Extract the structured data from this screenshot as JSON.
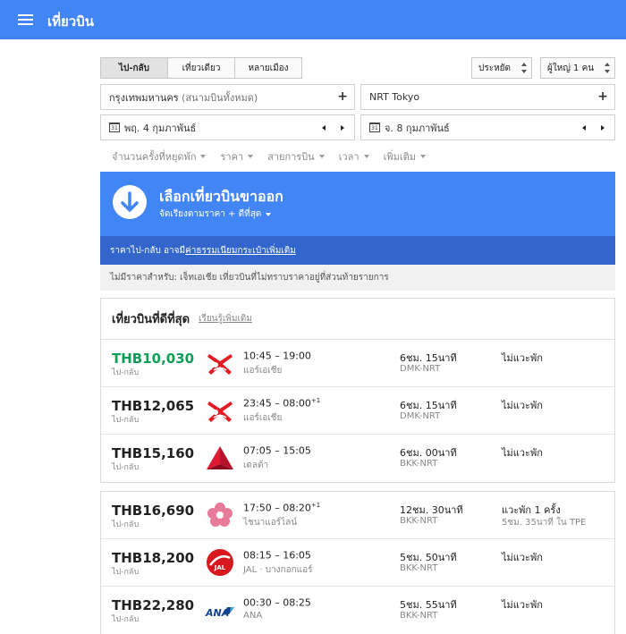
{
  "header": {
    "title": "เที่ยวบิน"
  },
  "trip_tabs": [
    {
      "label": "ไป-กลับ",
      "active": true
    },
    {
      "label": "เที่ยวเดียว",
      "active": false
    },
    {
      "label": "หลายเมือง",
      "active": false
    }
  ],
  "cabin_select": {
    "value": "ประหยัด"
  },
  "passengers_select": {
    "value": "ผู้ใหญ่ 1 คน"
  },
  "origin": {
    "value": "กรุงเทพมหานคร",
    "detail": "(สนามบินทั้งหมด)"
  },
  "destination": {
    "value": "NRT Tokyo"
  },
  "depart_date": {
    "value": "พฤ. 4 กุมภาพันธ์",
    "icon_day": "31"
  },
  "return_date": {
    "value": "จ. 8 กุมภาพันธ์",
    "icon_day": "31"
  },
  "filters": [
    "จำนวนครั้งที่หยุดพัก",
    "ราคา",
    "สายการบิน",
    "เวลา",
    "เพิ่มเติม"
  ],
  "banner": {
    "title": "เลือกเที่ยวบินขาออก",
    "sort_label": "จัดเรียงตามราคา + ดีที่สุด",
    "bag_notice_prefix": "ราคาไป-กลับ อาจมี",
    "bag_notice_link": "ค่าธรรมเนียมกระเป๋าเพิ่มเติม",
    "unavailable_note": "ไม่มีราคาสำหรับ: เจ็ทเอเชีย เที่ยวบินที่ไม่ทราบราคาอยู่ที่ส่วนท้ายรายการ"
  },
  "best_flights": {
    "heading": "เที่ยวบินที่ดีที่สุด",
    "learn_more": "เรียนรู้เพิ่มเติม",
    "flights": [
      {
        "price": "THB10,030",
        "price_type": "ไป-กลับ",
        "times": "10:45 – 19:00",
        "plus_day": "",
        "airline": "แอร์เอเชีย",
        "logo": "airasia-logo",
        "duration": "6ชม. 15นาที",
        "route": "DMK-NRT",
        "stops": "ไม่แวะพัก",
        "stop_detail": ""
      },
      {
        "price": "THB12,065",
        "price_type": "ไป-กลับ",
        "times": "23:45 – 08:00",
        "plus_day": "+1",
        "airline": "แอร์เอเชีย",
        "logo": "airasia-logo",
        "duration": "6ชม. 15นาที",
        "route": "DMK-NRT",
        "stops": "ไม่แวะพัก",
        "stop_detail": ""
      },
      {
        "price": "THB15,160",
        "price_type": "ไป-กลับ",
        "times": "07:05 – 15:05",
        "plus_day": "",
        "airline": "เดลต้า",
        "logo": "delta-logo",
        "duration": "6ชม. 00นาที",
        "route": "BKK-NRT",
        "stops": "ไม่แวะพัก",
        "stop_detail": ""
      }
    ]
  },
  "other_flights": [
    {
      "price": "THB16,690",
      "price_type": "ไป-กลับ",
      "times": "17:50 – 08:20",
      "plus_day": "+1",
      "airline": "ไชนาแอร์ไลน์",
      "logo": "china-airlines-logo",
      "duration": "12ชม. 30นาที",
      "route": "BKK-NRT",
      "stops": "แวะพัก 1 ครั้ง",
      "stop_detail": "5ชม. 35นาที ใน TPE"
    },
    {
      "price": "THB18,200",
      "price_type": "ไป-กลับ",
      "times": "08:15 – 16:05",
      "plus_day": "",
      "airline": "JAL · บางกอกแอร์",
      "logo": "jal-logo",
      "duration": "5ชม. 50นาที",
      "route": "BKK-NRT",
      "stops": "ไม่แวะพัก",
      "stop_detail": ""
    },
    {
      "price": "THB22,280",
      "price_type": "ไป-กลับ",
      "times": "00:30 – 08:25",
      "plus_day": "",
      "airline": "ANA",
      "logo": "ana-logo",
      "duration": "5ชม. 55นาที",
      "route": "BKK-NRT",
      "stops": "ไม่แวะพัก",
      "stop_detail": ""
    }
  ],
  "colors": {
    "brand": "#4285f4",
    "notice": "#3266cc",
    "best_price": "#0f9d58"
  }
}
